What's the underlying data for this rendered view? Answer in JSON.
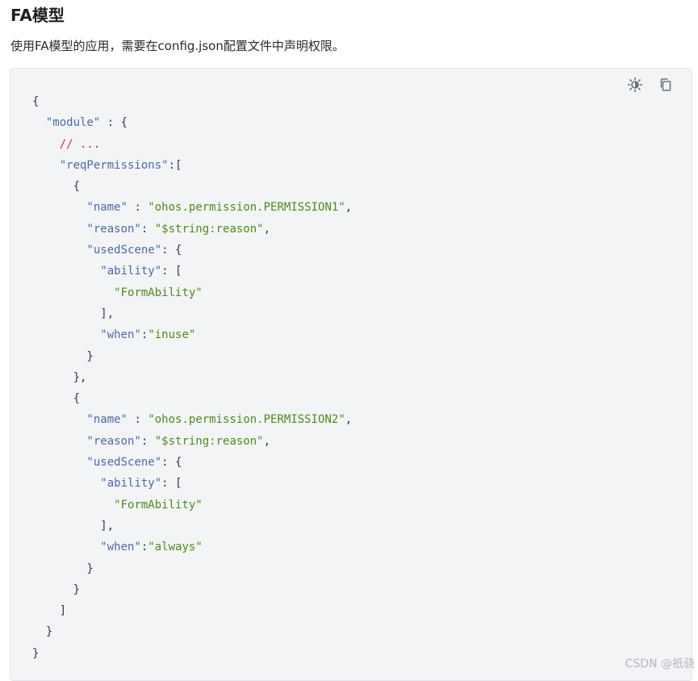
{
  "heading": "FA模型",
  "intro": "使用FA模型的应用，需要在config.json配置文件中声明权限。",
  "toolbar": {
    "theme_icon": "theme-toggle-icon",
    "copy_icon": "copy-icon"
  },
  "code_lines": [
    [
      {
        "t": "{",
        "c": "p"
      }
    ],
    [
      {
        "t": "  ",
        "c": "p"
      },
      {
        "t": "\"module\"",
        "c": "k"
      },
      {
        "t": " : {",
        "c": "p"
      }
    ],
    [
      {
        "t": "    ",
        "c": "p"
      },
      {
        "t": "// ...",
        "c": "c"
      }
    ],
    [
      {
        "t": "    ",
        "c": "p"
      },
      {
        "t": "\"reqPermissions\"",
        "c": "k"
      },
      {
        "t": ":[",
        "c": "p"
      }
    ],
    [
      {
        "t": "      {",
        "c": "p"
      }
    ],
    [
      {
        "t": "        ",
        "c": "p"
      },
      {
        "t": "\"name\"",
        "c": "k"
      },
      {
        "t": " : ",
        "c": "p"
      },
      {
        "t": "\"ohos.permission.PERMISSION1\"",
        "c": "s"
      },
      {
        "t": ",",
        "c": "p"
      }
    ],
    [
      {
        "t": "        ",
        "c": "p"
      },
      {
        "t": "\"reason\"",
        "c": "k"
      },
      {
        "t": ": ",
        "c": "p"
      },
      {
        "t": "\"$string:reason\"",
        "c": "s"
      },
      {
        "t": ",",
        "c": "p"
      }
    ],
    [
      {
        "t": "        ",
        "c": "p"
      },
      {
        "t": "\"usedScene\"",
        "c": "k"
      },
      {
        "t": ": {",
        "c": "p"
      }
    ],
    [
      {
        "t": "          ",
        "c": "p"
      },
      {
        "t": "\"ability\"",
        "c": "k"
      },
      {
        "t": ": [",
        "c": "p"
      }
    ],
    [
      {
        "t": "            ",
        "c": "p"
      },
      {
        "t": "\"FormAbility\"",
        "c": "s"
      }
    ],
    [
      {
        "t": "          ],",
        "c": "p"
      }
    ],
    [
      {
        "t": "          ",
        "c": "p"
      },
      {
        "t": "\"when\"",
        "c": "k"
      },
      {
        "t": ":",
        "c": "p"
      },
      {
        "t": "\"inuse\"",
        "c": "s"
      }
    ],
    [
      {
        "t": "        }",
        "c": "p"
      }
    ],
    [
      {
        "t": "      },",
        "c": "p"
      }
    ],
    [
      {
        "t": "      {",
        "c": "p"
      }
    ],
    [
      {
        "t": "        ",
        "c": "p"
      },
      {
        "t": "\"name\"",
        "c": "k"
      },
      {
        "t": " : ",
        "c": "p"
      },
      {
        "t": "\"ohos.permission.PERMISSION2\"",
        "c": "s"
      },
      {
        "t": ",",
        "c": "p"
      }
    ],
    [
      {
        "t": "        ",
        "c": "p"
      },
      {
        "t": "\"reason\"",
        "c": "k"
      },
      {
        "t": ": ",
        "c": "p"
      },
      {
        "t": "\"$string:reason\"",
        "c": "s"
      },
      {
        "t": ",",
        "c": "p"
      }
    ],
    [
      {
        "t": "        ",
        "c": "p"
      },
      {
        "t": "\"usedScene\"",
        "c": "k"
      },
      {
        "t": ": {",
        "c": "p"
      }
    ],
    [
      {
        "t": "          ",
        "c": "p"
      },
      {
        "t": "\"ability\"",
        "c": "k"
      },
      {
        "t": ": [",
        "c": "p"
      }
    ],
    [
      {
        "t": "            ",
        "c": "p"
      },
      {
        "t": "\"FormAbility\"",
        "c": "s"
      }
    ],
    [
      {
        "t": "          ],",
        "c": "p"
      }
    ],
    [
      {
        "t": "          ",
        "c": "p"
      },
      {
        "t": "\"when\"",
        "c": "k"
      },
      {
        "t": ":",
        "c": "p"
      },
      {
        "t": "\"always\"",
        "c": "s"
      }
    ],
    [
      {
        "t": "        }",
        "c": "p"
      }
    ],
    [
      {
        "t": "      }",
        "c": "p"
      }
    ],
    [
      {
        "t": "    ]",
        "c": "p"
      }
    ],
    [
      {
        "t": "  }",
        "c": "p"
      }
    ],
    [
      {
        "t": "}",
        "c": "p"
      }
    ]
  ],
  "watermark": "CSDN @祇骁",
  "colors": {
    "key": "#4e6aa6",
    "string": "#4f8a1e",
    "comment": "#d32f2f",
    "code_bg": "#f3f4f6"
  }
}
